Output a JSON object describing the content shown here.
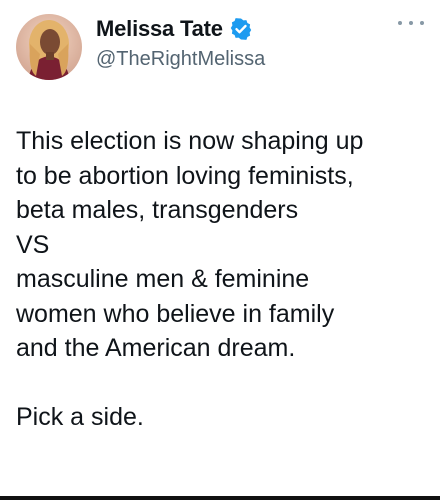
{
  "author": {
    "display_name": "Melissa Tate",
    "handle": "@TheRightMelissa",
    "verified": true,
    "verified_color": "#1d9bf0",
    "avatar_icon": "profile-photo"
  },
  "menu_icon": "more-dots-icon",
  "tweet": {
    "lines": [
      "This election is now shaping up",
      "to be abortion loving feminists,",
      "beta males, transgenders",
      "VS",
      "masculine men & feminine",
      "women who believe in family",
      "and the American dream."
    ],
    "closing": "Pick a side."
  }
}
